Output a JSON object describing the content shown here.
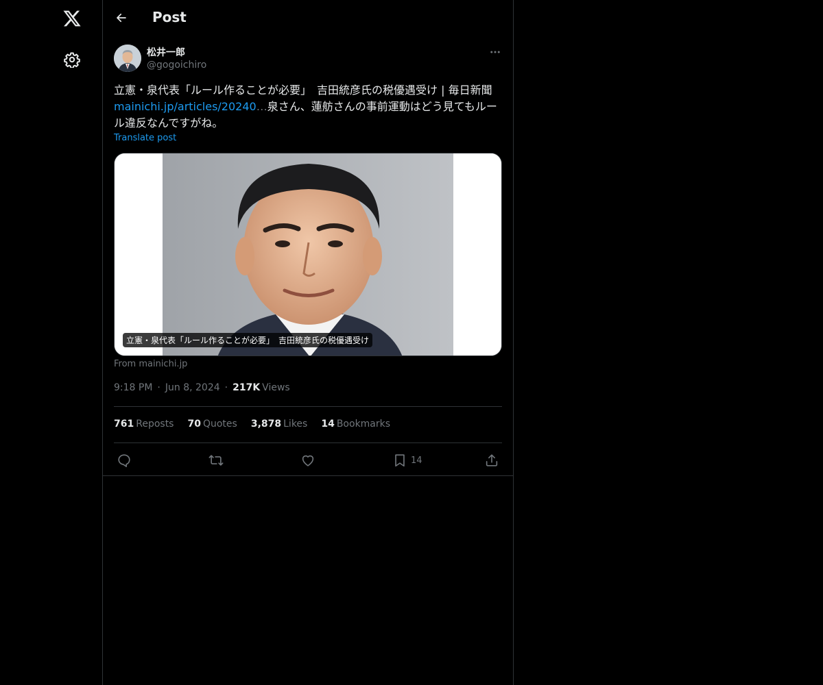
{
  "header": {
    "title": "Post"
  },
  "author": {
    "name": "松井一郎",
    "handle": "@gogoichiro"
  },
  "post": {
    "text_before_link": "立憲・泉代表「ルール作ることが必要」　吉田統彦氏の税優遇受け | 毎日新聞 ",
    "link_text": "mainichi.jp/articles/20240",
    "link_ellipsis": "…",
    "text_after_link": "泉さん、蓮舫さんの事前運動はどう見てもルール違反なんですがね。",
    "translate_label": "Translate post"
  },
  "card": {
    "caption": "立憲・泉代表「ルール作ることが必要」　吉田統彦氏の税優遇受け",
    "source": "From mainichi.jp"
  },
  "meta": {
    "time": "9:18 PM",
    "date": "Jun 8, 2024",
    "views_count": "217K",
    "views_label": "Views"
  },
  "stats": [
    {
      "count": "761",
      "label": "Reposts"
    },
    {
      "count": "70",
      "label": "Quotes"
    },
    {
      "count": "3,878",
      "label": "Likes"
    },
    {
      "count": "14",
      "label": "Bookmarks"
    }
  ],
  "actions": {
    "bookmark_count": "14"
  },
  "colors": {
    "accent": "#1d9bf0",
    "text": "#e7e9ea",
    "muted": "#71767b",
    "border": "#2f3336"
  },
  "icons": {
    "logo": "x-logo-icon",
    "settings": "gear-icon",
    "back": "back-arrow-icon",
    "more": "more-dots-icon",
    "reply": "reply-icon",
    "repost": "repost-icon",
    "like": "heart-icon",
    "bookmark": "bookmark-icon",
    "share": "share-icon"
  }
}
